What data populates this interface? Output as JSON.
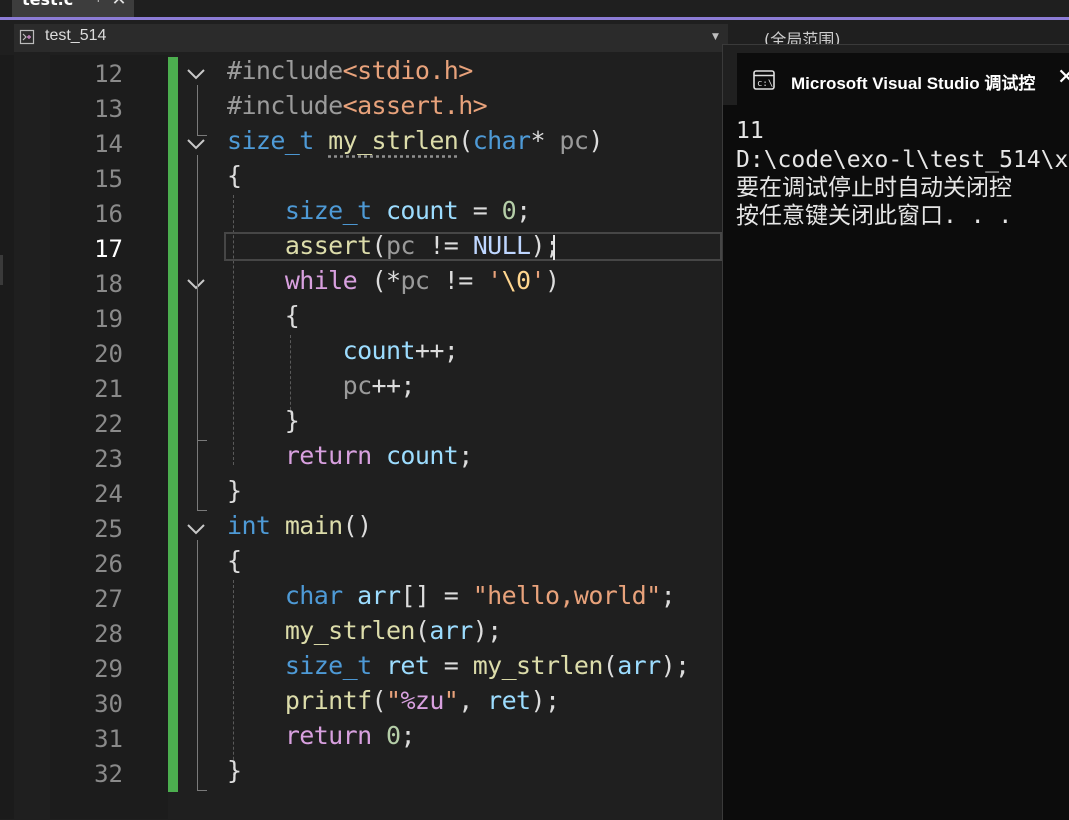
{
  "tab": {
    "title": "test.c",
    "pin_glyph": "⊣",
    "close_glyph": "✕"
  },
  "navbar": {
    "project": "test_514",
    "scope": "(全局范围)"
  },
  "editor": {
    "active_line": 17,
    "line_numbers": [
      "12",
      "13",
      "14",
      "15",
      "16",
      "17",
      "18",
      "19",
      "20",
      "21",
      "22",
      "23",
      "24",
      "25",
      "26",
      "27",
      "28",
      "29",
      "30",
      "31",
      "32"
    ],
    "lines": [
      [
        {
          "t": "#include",
          "c": "pp"
        },
        {
          "t": "<stdio.h>",
          "c": "hd"
        }
      ],
      [
        {
          "t": "#include",
          "c": "pp"
        },
        {
          "t": "<assert.h>",
          "c": "hd"
        }
      ],
      [
        {
          "t": "size_t",
          "c": "ty"
        },
        {
          "t": " ",
          "c": "tx"
        },
        {
          "t": "my_strlen",
          "c": "fn squig"
        },
        {
          "t": "(",
          "c": "tx"
        },
        {
          "t": "char",
          "c": "ty"
        },
        {
          "t": "* ",
          "c": "tx"
        },
        {
          "t": "pc",
          "c": "pa"
        },
        {
          "t": ")",
          "c": "tx"
        }
      ],
      [
        {
          "t": "{",
          "c": "tx"
        }
      ],
      [
        {
          "t": "    ",
          "c": "tx"
        },
        {
          "t": "size_t",
          "c": "ty"
        },
        {
          "t": " ",
          "c": "tx"
        },
        {
          "t": "count",
          "c": "va"
        },
        {
          "t": " = ",
          "c": "tx"
        },
        {
          "t": "0",
          "c": "nu"
        },
        {
          "t": ";",
          "c": "tx"
        }
      ],
      [
        {
          "t": "    ",
          "c": "tx"
        },
        {
          "t": "assert",
          "c": "fn"
        },
        {
          "t": "(",
          "c": "tx"
        },
        {
          "t": "pc",
          "c": "pa"
        },
        {
          "t": " != ",
          "c": "tx"
        },
        {
          "t": "NULL",
          "c": "ma"
        },
        {
          "t": ");",
          "c": "tx"
        }
      ],
      [
        {
          "t": "    ",
          "c": "tx"
        },
        {
          "t": "while",
          "c": "kw"
        },
        {
          "t": " (*",
          "c": "tx"
        },
        {
          "t": "pc",
          "c": "pa"
        },
        {
          "t": " != ",
          "c": "tx"
        },
        {
          "t": "'",
          "c": "st"
        },
        {
          "t": "\\0",
          "c": "es"
        },
        {
          "t": "'",
          "c": "st"
        },
        {
          "t": ")",
          "c": "tx"
        }
      ],
      [
        {
          "t": "    {",
          "c": "tx"
        }
      ],
      [
        {
          "t": "        ",
          "c": "tx"
        },
        {
          "t": "count",
          "c": "va"
        },
        {
          "t": "++;",
          "c": "tx"
        }
      ],
      [
        {
          "t": "        ",
          "c": "tx"
        },
        {
          "t": "pc",
          "c": "pa"
        },
        {
          "t": "++;",
          "c": "tx"
        }
      ],
      [
        {
          "t": "    }",
          "c": "tx"
        }
      ],
      [
        {
          "t": "    ",
          "c": "tx"
        },
        {
          "t": "return",
          "c": "kw"
        },
        {
          "t": " ",
          "c": "tx"
        },
        {
          "t": "count",
          "c": "va"
        },
        {
          "t": ";",
          "c": "tx"
        }
      ],
      [
        {
          "t": "}",
          "c": "tx"
        }
      ],
      [
        {
          "t": "int",
          "c": "ty"
        },
        {
          "t": " ",
          "c": "tx"
        },
        {
          "t": "main",
          "c": "fn"
        },
        {
          "t": "()",
          "c": "tx"
        }
      ],
      [
        {
          "t": "{",
          "c": "tx"
        }
      ],
      [
        {
          "t": "    ",
          "c": "tx"
        },
        {
          "t": "char",
          "c": "ty"
        },
        {
          "t": " ",
          "c": "tx"
        },
        {
          "t": "arr",
          "c": "va"
        },
        {
          "t": "[] = ",
          "c": "tx"
        },
        {
          "t": "\"hello,world\"",
          "c": "st"
        },
        {
          "t": ";",
          "c": "tx"
        }
      ],
      [
        {
          "t": "    ",
          "c": "tx"
        },
        {
          "t": "my_strlen",
          "c": "fn"
        },
        {
          "t": "(",
          "c": "tx"
        },
        {
          "t": "arr",
          "c": "va"
        },
        {
          "t": ");",
          "c": "tx"
        }
      ],
      [
        {
          "t": "    ",
          "c": "tx"
        },
        {
          "t": "size_t",
          "c": "ty"
        },
        {
          "t": " ",
          "c": "tx"
        },
        {
          "t": "ret",
          "c": "va"
        },
        {
          "t": " = ",
          "c": "tx"
        },
        {
          "t": "my_strlen",
          "c": "fn"
        },
        {
          "t": "(",
          "c": "tx"
        },
        {
          "t": "arr",
          "c": "va"
        },
        {
          "t": ");",
          "c": "tx"
        }
      ],
      [
        {
          "t": "    ",
          "c": "tx"
        },
        {
          "t": "printf",
          "c": "fn"
        },
        {
          "t": "(",
          "c": "tx"
        },
        {
          "t": "\"",
          "c": "st"
        },
        {
          "t": "%zu",
          "c": "kw"
        },
        {
          "t": "\"",
          "c": "st"
        },
        {
          "t": ", ",
          "c": "tx"
        },
        {
          "t": "ret",
          "c": "va"
        },
        {
          "t": ");",
          "c": "tx"
        }
      ],
      [
        {
          "t": "    ",
          "c": "tx"
        },
        {
          "t": "return",
          "c": "kw"
        },
        {
          "t": " ",
          "c": "tx"
        },
        {
          "t": "0",
          "c": "nu"
        },
        {
          "t": ";",
          "c": "tx"
        }
      ],
      [
        {
          "t": "}",
          "c": "tx"
        }
      ]
    ]
  },
  "console": {
    "title": "Microsoft Visual Studio 调试控",
    "close_glyph": "✕",
    "output": [
      "11",
      "D:\\code\\exo-l\\test_514\\x",
      "要在调试停止时自动关闭控",
      "按任意键关闭此窗口. . ."
    ]
  },
  "colors": {
    "accent": "#8c7cd6",
    "change_bar": "#4cae4f"
  }
}
